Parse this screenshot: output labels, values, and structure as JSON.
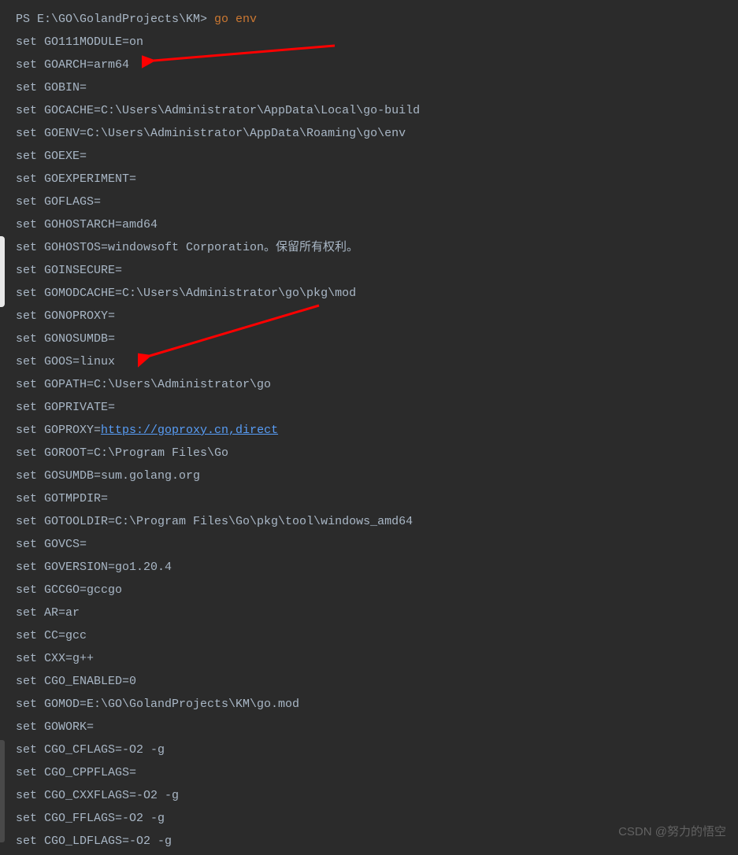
{
  "prompt_prefix": "PS E:\\GO\\GolandProjects\\KM> ",
  "command": "go env",
  "proxy_url": "https://goproxy.cn,direct",
  "watermark": "CSDN @努力的悟空",
  "lines": [
    "set GO111MODULE=on",
    "set GOARCH=arm64",
    "set GOBIN=",
    "set GOCACHE=C:\\Users\\Administrator\\AppData\\Local\\go-build",
    "set GOENV=C:\\Users\\Administrator\\AppData\\Roaming\\go\\env",
    "set GOEXE=",
    "set GOEXPERIMENT=",
    "set GOFLAGS=",
    "set GOHOSTARCH=amd64",
    "set GOHOSTOS=windowsoft Corporation。保留所有权利。",
    "set GOINSECURE=",
    "set GOMODCACHE=C:\\Users\\Administrator\\go\\pkg\\mod",
    "set GONOPROXY=",
    "set GONOSUMDB=",
    "set GOOS=linux",
    "set GOPATH=C:\\Users\\Administrator\\go",
    "set GOPRIVATE=",
    "set GOPROXY=",
    "set GOROOT=C:\\Program Files\\Go",
    "set GOSUMDB=sum.golang.org",
    "set GOTMPDIR=",
    "set GOTOOLDIR=C:\\Program Files\\Go\\pkg\\tool\\windows_amd64",
    "set GOVCS=",
    "set GOVERSION=go1.20.4",
    "set GCCGO=gccgo",
    "set AR=ar",
    "set CC=gcc",
    "set CXX=g++",
    "set CGO_ENABLED=0",
    "set GOMOD=E:\\GO\\GolandProjects\\KM\\go.mod",
    "set GOWORK=",
    "set CGO_CFLAGS=-O2 -g",
    "set CGO_CPPFLAGS=",
    "set CGO_CXXFLAGS=-O2 -g",
    "set CGO_FFLAGS=-O2 -g",
    "set CGO_LDFLAGS=-O2 -g"
  ]
}
